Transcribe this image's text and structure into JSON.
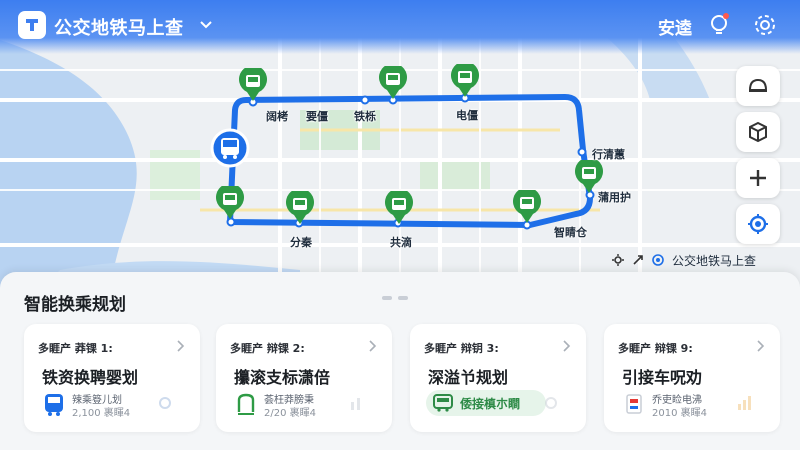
{
  "header": {
    "app_title": "公交地铁马上查",
    "action_label": "安逵",
    "icons": [
      "app-logo-icon",
      "chevron-down-icon",
      "bulb-icon",
      "settings-icon"
    ],
    "brand_color": "#3d7ef0"
  },
  "map": {
    "route_color": "#1e6fe8",
    "stop_color": "#2e9b45",
    "stops": [
      {
        "label": "阔栲"
      },
      {
        "label": "要僵"
      },
      {
        "label": "铁栎"
      },
      {
        "label": "电僵"
      },
      {
        "label": "行清蕙"
      },
      {
        "label": "蒲用护"
      },
      {
        "label": "智睛仓"
      },
      {
        "label": "共滴"
      },
      {
        "label": "分秦"
      }
    ],
    "footer_text": "公交地铁马上查",
    "controls": [
      "helmet-icon",
      "cube-icon",
      "plus-icon",
      "locate-icon"
    ]
  },
  "sheet": {
    "title": "智能换乘规划",
    "cards": [
      {
        "tag": "多睚产 莽锞 1:",
        "name": "铁资换聘婴划",
        "sub1": "辣乘簦儿划",
        "sub2": "2,100 裹睴4",
        "icon": "bus-icon"
      },
      {
        "tag": "多睚产 辩锞 2:",
        "name": "攥滚支标潇倍",
        "sub1": "荟枉莽膀秉",
        "sub2": "2/20 裹睴4",
        "icon": "metro-icon"
      },
      {
        "tag": "多睚产 辩钥 3:",
        "name": "深溢兯规划",
        "pill": "倭接槙朩瞷",
        "icon": "bus-icon"
      },
      {
        "tag": "多睚产 辩锞 9:",
        "name": "引接车呪劝",
        "sub1": "乔吏睑电沸",
        "sub2": "2010 裹睴4",
        "icon": "card-icon"
      }
    ]
  }
}
